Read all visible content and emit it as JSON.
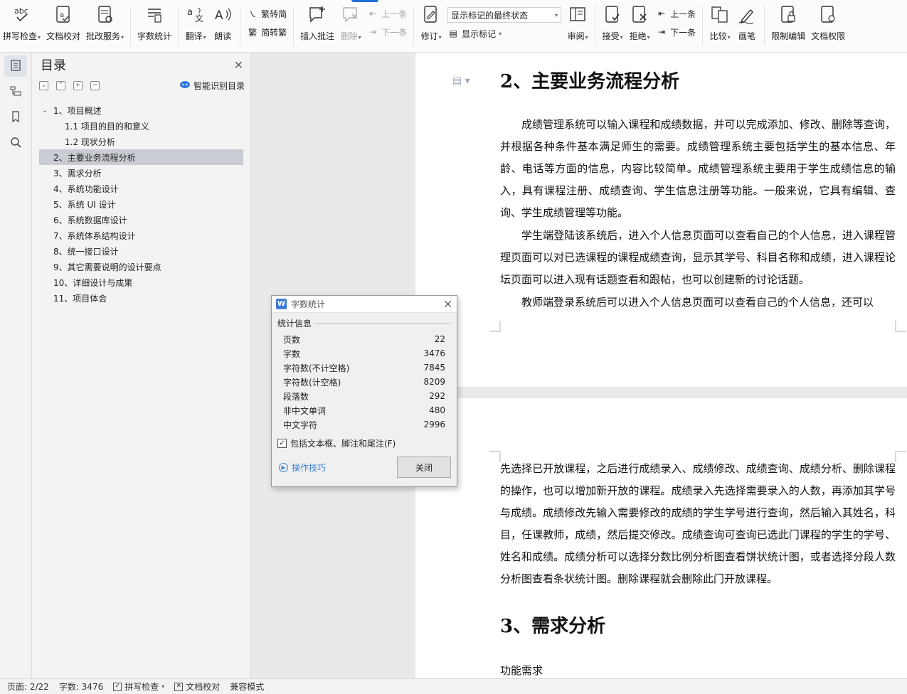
{
  "ribbon": {
    "spell_check": "拼写检查",
    "doc_proof": "文档校对",
    "review_service": "批改服务",
    "word_count": "字数统计",
    "translate": "翻译",
    "read_aloud": "朗读",
    "trad_to_simp": "繁转简",
    "simp_to_trad": "简转繁",
    "insert_comment": "插入批注",
    "delete": "删除",
    "prev_comment": "上一条",
    "next_comment": "下一条",
    "track_changes": "修订",
    "display_state": "显示标记的最终状态",
    "show_markup": "显示标记",
    "review": "审阅",
    "accept": "接受",
    "reject": "拒绝",
    "prev_change": "上一条",
    "next_change": "下一条",
    "compare": "比较",
    "pen": "画笔",
    "restrict_edit": "限制编辑",
    "doc_permission": "文档权限"
  },
  "toc": {
    "title": "目录",
    "smart_label": "智能识别目录",
    "items": [
      {
        "label": "1、项目概述"
      },
      {
        "label": "1.1 项目的目的和意义"
      },
      {
        "label": "1.2 现状分析"
      },
      {
        "label": "2、主要业务流程分析"
      },
      {
        "label": "3、需求分析"
      },
      {
        "label": "4、系统功能设计"
      },
      {
        "label": "5、系统 UI 设计"
      },
      {
        "label": "6、系统数据库设计"
      },
      {
        "label": "7、系统体系结构设计"
      },
      {
        "label": "8、统一接口设计"
      },
      {
        "label": "9、其它需要说明的设计要点"
      },
      {
        "label": "10、详细设计与成果"
      },
      {
        "label": "11、项目体会"
      }
    ]
  },
  "document": {
    "heading1": "2、主要业务流程分析",
    "para1": "成绩管理系统可以输入课程和成绩数据，并可以完成添加、修改、删除等查询，并根据各种条件基本满足师生的需要。成绩管理系统主要包括学生的基本信息、年龄、电话等方面的信息，内容比较简单。成绩管理系统主要用于学生成绩信息的输入，具有课程注册、成绩查询、学生信息注册等功能。一般来说，它具有编辑、查询、学生成绩管理等功能。",
    "para2": "学生端登陆该系统后，进入个人信息页面可以查看自己的个人信息，进入课程管理页面可以对已选课程的课程成绩查询，显示其学号、科目名称和成绩，进入课程论坛页面可以进入现有话题查看和跟帖，也可以创建新的讨论话题。",
    "para3": "教师端登录系统后可以进入个人信息页面可以查看自己的个人信息，还可以",
    "para4": "先选择已开放课程，之后进行成绩录入、成绩修改、成绩查询、成绩分析、删除课程的操作，也可以增加新开放的课程。成绩录入先选择需要录入的人数，再添加其学号与成绩。成绩修改先输入需要修改的成绩的学生学号进行查询，然后输入其姓名，科目，任课教师，成绩，然后提交修改。成绩查询可查询已选此门课程的学生的学号、姓名和成绩。成绩分析可以选择分数比例分析图查看饼状统计图，或者选择分段人数分析图查看条状统计图。删除课程就会删除此门开放课程。",
    "heading2": "3、需求分析",
    "para5": "功能需求"
  },
  "dialog": {
    "title": "字数统计",
    "group": "统计信息",
    "stats": [
      {
        "label": "页数",
        "value": "22"
      },
      {
        "label": "字数",
        "value": "3476"
      },
      {
        "label": "字符数(不计空格)",
        "value": "7845"
      },
      {
        "label": "字符数(计空格)",
        "value": "8209"
      },
      {
        "label": "段落数",
        "value": "292"
      },
      {
        "label": "非中文单词",
        "value": "480"
      },
      {
        "label": "中文字符",
        "value": "2996"
      }
    ],
    "include_label": "包括文本框、脚注和尾注(F)",
    "include_checked": true,
    "tips_label": "操作技巧",
    "close_label": "关闭"
  },
  "statusbar": {
    "page": "页面: 2/22",
    "words": "字数: 3476",
    "spell_check": "拼写检查",
    "doc_proof": "文档校对",
    "compat_mode": "兼容模式"
  },
  "colors": {
    "accent": "#1e6fd9",
    "link": "#3f7fd6",
    "selected_row": "#c9ccd2"
  }
}
